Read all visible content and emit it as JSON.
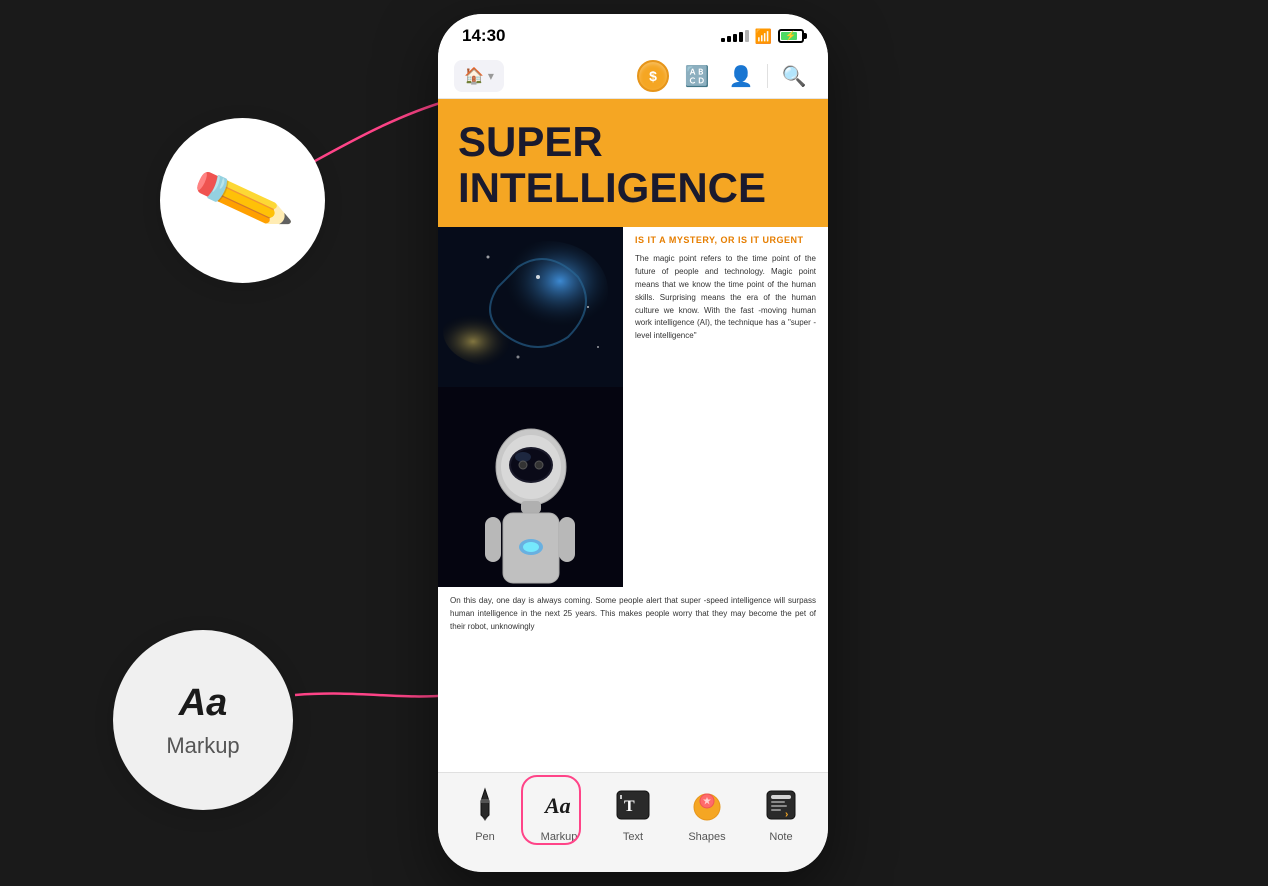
{
  "phone": {
    "statusBar": {
      "time": "14:30"
    },
    "document": {
      "title1": "SUPER",
      "title2": "INTELLIGENCE",
      "subtitle": "IS IT A MYSTERY, OR IS IT URGENT",
      "bodyText1": "The magic point refers to the time point of the future of people and technology. Magic point means that we know the time point of the human skills. Surprising means the era of the human culture we know. With the fast -moving human work intelligence (AI), the technique has a \"super -level intelligence\"",
      "bodyText2": "On this day, one day is always coming. Some people alert that super -speed intelligence will surpass human intelligence in the next 25 years. This makes people worry that they may become the pet of their robot, unknowingly"
    },
    "toolbar": {
      "items": [
        {
          "id": "pen",
          "label": "Pen",
          "icon": "✒"
        },
        {
          "id": "markup",
          "label": "Markup",
          "icon": "𝐀𝐚"
        },
        {
          "id": "text",
          "label": "Text",
          "icon": "𝕋"
        },
        {
          "id": "shapes",
          "label": "Shapes",
          "icon": "♦"
        },
        {
          "id": "note",
          "label": "Note",
          "icon": "📋"
        }
      ]
    }
  },
  "callouts": {
    "pen": {
      "description": "Eraser / pen tool"
    },
    "markup": {
      "label": "Markup",
      "aa": "Aa"
    }
  },
  "colors": {
    "accent": "#f5a623",
    "highlight": "#ff4488",
    "dark": "#1a1a2e"
  }
}
